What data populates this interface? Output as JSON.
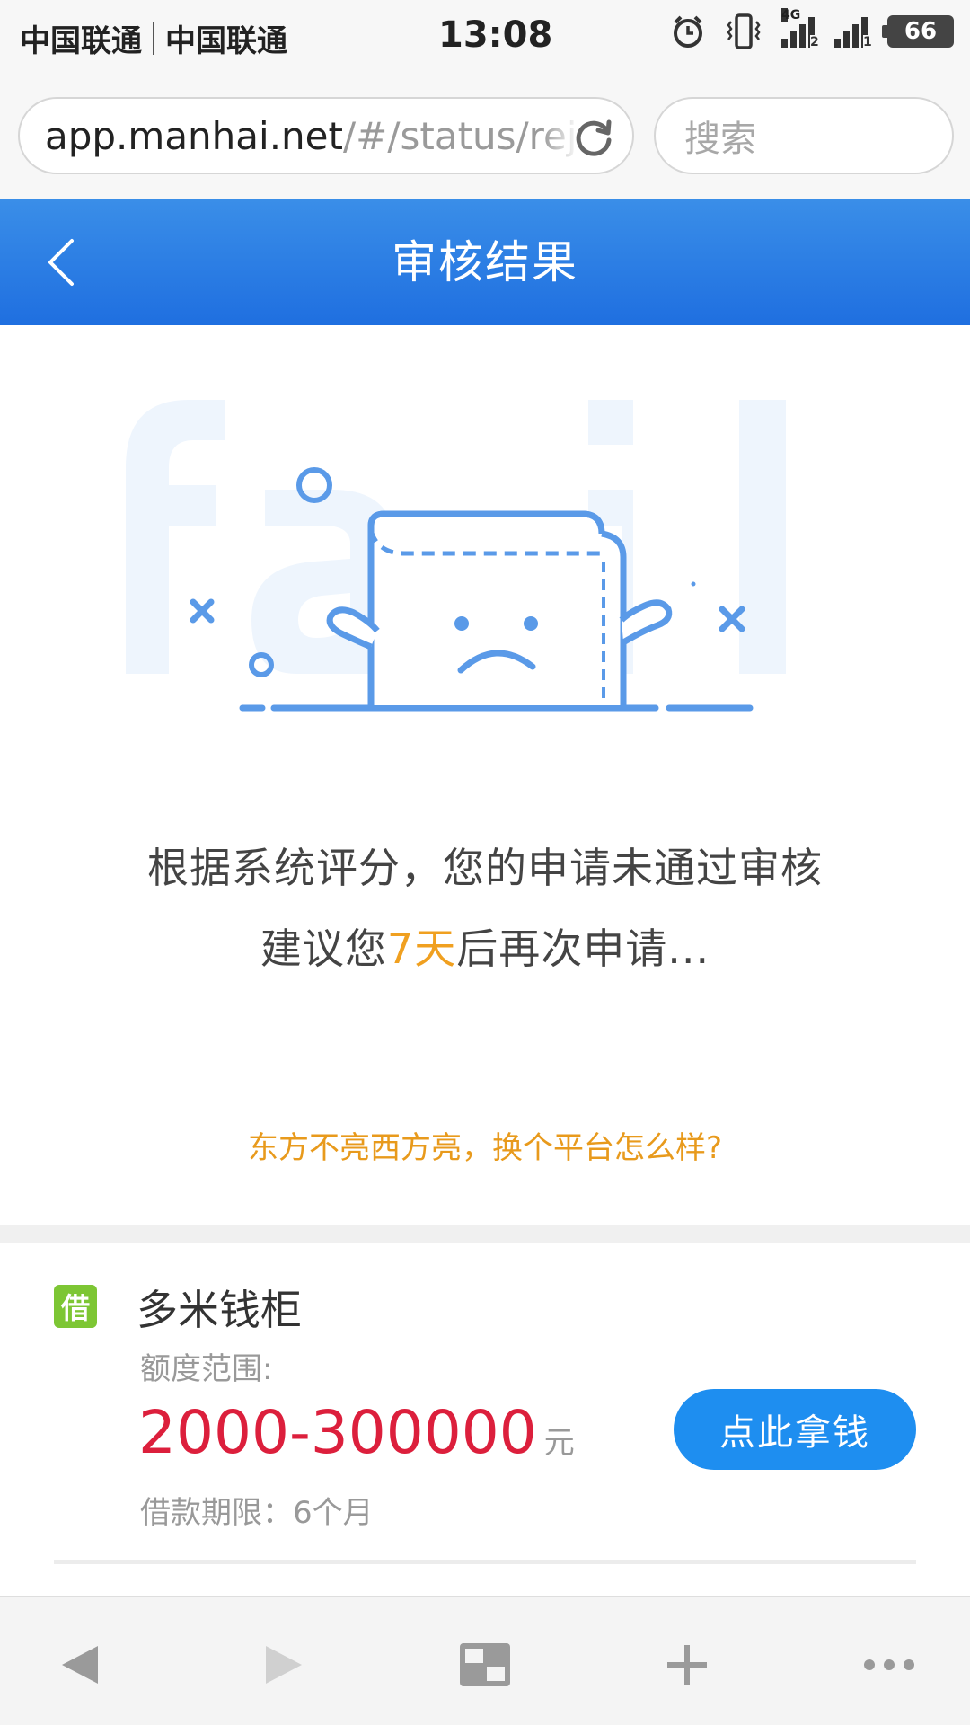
{
  "status_bar": {
    "carrier_1": "中国联通",
    "carrier_2": "中国联通",
    "time": "13:08",
    "network": "4G",
    "sim_1": "2",
    "sim_2": "1",
    "battery": "66"
  },
  "browser": {
    "url_host": "app.manhai.net",
    "url_path": "/#/status/rej",
    "search_placeholder": "搜索"
  },
  "header": {
    "title": "审核结果"
  },
  "result": {
    "message_line1": "根据系统评分，您的申请未通过审核",
    "message_line2_prefix": "建议您",
    "message_days": "7天",
    "message_line2_suffix": "后再次申请...",
    "suggestion": "东方不亮西方亮，换个平台怎么样?"
  },
  "product": {
    "badge": "借",
    "name": "多米钱柜",
    "range_label": "额度范围:",
    "range_value": "2000-300000",
    "range_unit": "元",
    "term": "借款期限：6个月",
    "cta_label": "点此拿钱"
  },
  "colors": {
    "header_blue": "#1f6fe0",
    "accent_orange": "#f0a020",
    "amount_red": "#dc1f3c",
    "button_blue": "#1e8ef0",
    "badge_green": "#7dc634"
  },
  "icons": {
    "refresh": "refresh-icon",
    "back": "chevron-left-icon",
    "toolbar": [
      "back-arrow-icon",
      "forward-arrow-icon",
      "tabs-icon",
      "plus-icon",
      "more-icon"
    ]
  }
}
